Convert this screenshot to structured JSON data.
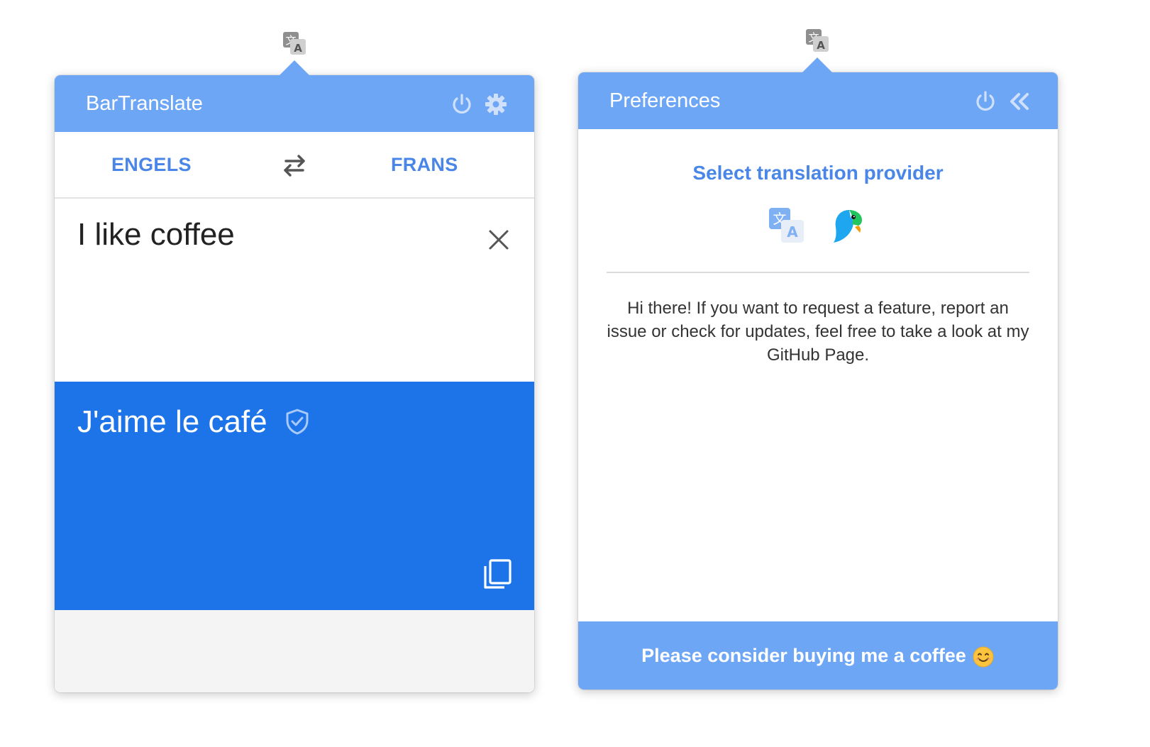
{
  "colors": {
    "header_blue": "#6ea6f6",
    "result_blue": "#1c74e8",
    "accent_text": "#4a86e8",
    "footer_gray": "#f4f4f4"
  },
  "translator": {
    "title": "BarTranslate",
    "icons": {
      "tray": "translate-icon",
      "power": "power-icon",
      "settings": "gear-icon"
    },
    "source_language": "ENGELS",
    "target_language": "FRANS",
    "source_text": "I like coffee",
    "result_text": "J'aime le café"
  },
  "preferences": {
    "title": "Preferences",
    "icons": {
      "tray": "translate-icon",
      "power": "power-icon",
      "back": "double-chevron-left-icon"
    },
    "heading": "Select translation provider",
    "providers": [
      "google-translate-icon",
      "papago-parrot-icon"
    ],
    "info_text": "Hi there! If you want to request a feature, report an issue or check for updates, feel free to take a look at my GitHub Page.",
    "coffee_label": "Please consider buying me a coffee"
  }
}
